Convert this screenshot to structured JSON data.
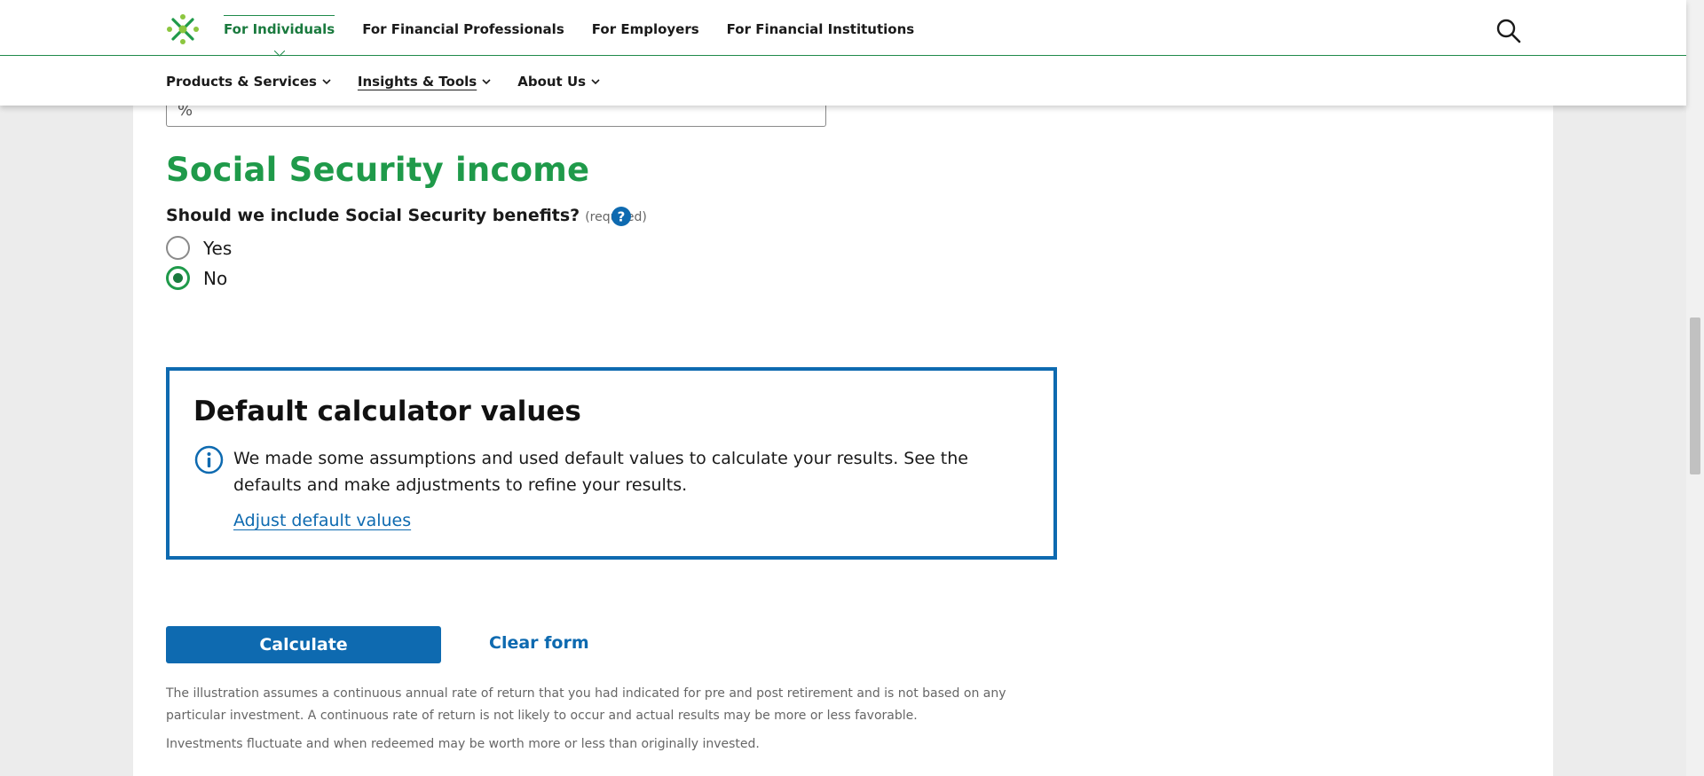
{
  "header": {
    "top_nav": [
      {
        "label": "For Individuals",
        "active": true
      },
      {
        "label": "For Financial Professionals",
        "active": false
      },
      {
        "label": "For Employers",
        "active": false
      },
      {
        "label": "For Financial Institutions",
        "active": false
      }
    ],
    "sub_nav": [
      {
        "label": "Products & Services"
      },
      {
        "label": "Insights & Tools"
      },
      {
        "label": "About Us"
      }
    ],
    "search_icon": "search-icon",
    "logo_icon": "brand-logo"
  },
  "form": {
    "percent_field_suffix": "%",
    "section_title": "Social Security income",
    "question": "Should we include Social Security benefits?",
    "required_label": "(required)",
    "options": [
      {
        "label": "Yes",
        "checked": false
      },
      {
        "label": "No",
        "checked": true
      }
    ]
  },
  "defaults_box": {
    "title": "Default calculator values",
    "text": "We made some assumptions and used default values to calculate your results. See the defaults and make adjustments to refine your results.",
    "link": "Adjust default values"
  },
  "actions": {
    "calculate": "Calculate",
    "clear": "Clear form"
  },
  "disclaimers": {
    "return_assumption": "The illustration assumes a continuous annual rate of return that you had indicated for pre and post retirement and is not based on any particular investment. A continuous rate of return is not likely to occur and actual results may be more or less favorable.",
    "fluctuation": "Investments fluctuate and when redeemed may be worth more or less than originally invested."
  },
  "colors": {
    "brand_green": "#1f9a4a",
    "link_blue": "#0e6ab0",
    "background": "#ececec"
  }
}
